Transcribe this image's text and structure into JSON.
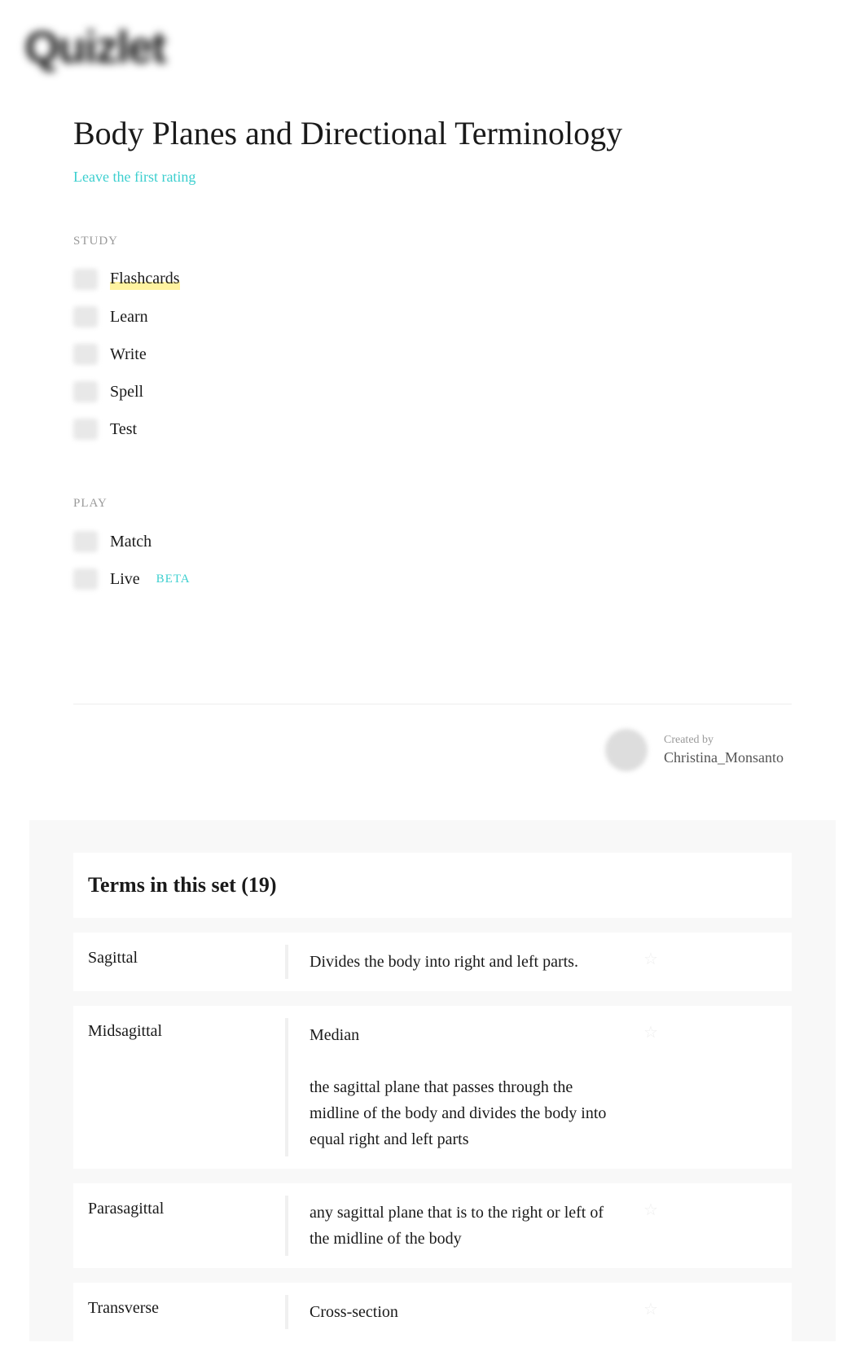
{
  "logo": "Quizlet",
  "title": "Body Planes and Directional Terminology",
  "rating_link": "Leave the first rating",
  "sections": {
    "study": {
      "header": "STUDY",
      "items": [
        {
          "label": "Flashcards",
          "highlighted": true
        },
        {
          "label": "Learn",
          "highlighted": false
        },
        {
          "label": "Write",
          "highlighted": false
        },
        {
          "label": "Spell",
          "highlighted": false
        },
        {
          "label": "Test",
          "highlighted": false
        }
      ]
    },
    "play": {
      "header": "PLAY",
      "items": [
        {
          "label": "Match",
          "badge": null
        },
        {
          "label": "Live",
          "badge": "BETA"
        }
      ]
    }
  },
  "creator": {
    "label": "Created by",
    "name": "Christina_Monsanto"
  },
  "terms": {
    "header": "Terms in this set (19)",
    "count": 19,
    "items": [
      {
        "term": "Sagittal",
        "definition": "Divides the body into right and left parts."
      },
      {
        "term": "Midsagittal",
        "definition": "Median\n\nthe sagittal plane that passes through the midline of the body and divides the body into equal right and left parts"
      },
      {
        "term": "Parasagittal",
        "definition": "any sagittal plane that is to the right or left of the midline of the body"
      },
      {
        "term": "Transverse",
        "definition": "Cross-section"
      }
    ]
  }
}
